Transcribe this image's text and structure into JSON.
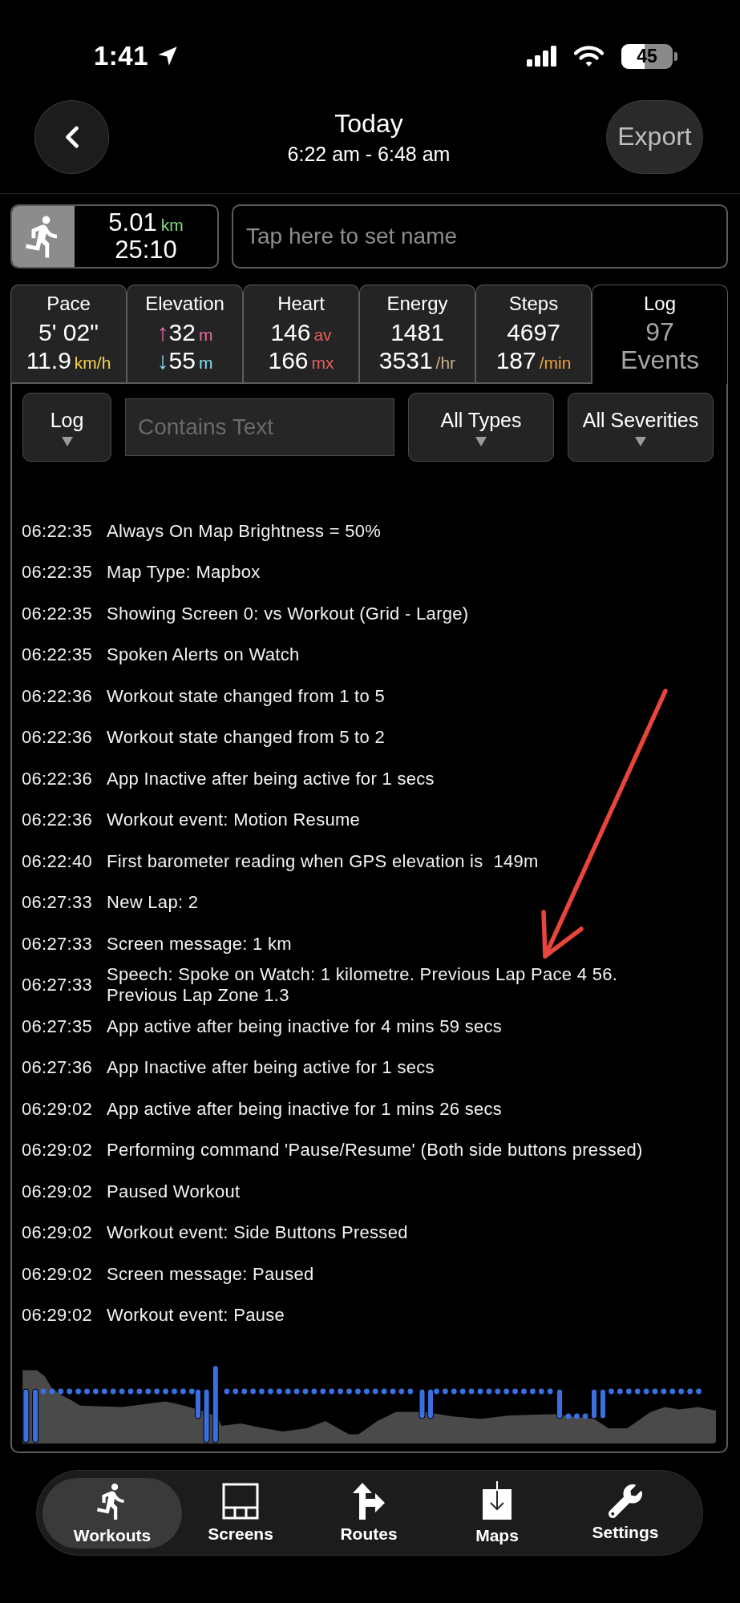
{
  "status_bar": {
    "time": "1:41",
    "battery": "45"
  },
  "header": {
    "title": "Today",
    "subtitle": "6:22 am - 6:48 am",
    "export_button": "Export"
  },
  "summary": {
    "distance": "5.01",
    "distance_unit": "km",
    "duration": "25:10",
    "name_field": {
      "placeholder": "Tap here to set name"
    }
  },
  "stat_tabs": [
    {
      "label": "Pace",
      "selected": false,
      "lines": [
        {
          "value": "5' 02\""
        },
        {
          "value": "11.9",
          "unit": "km/h",
          "color": "#f4d24c"
        }
      ]
    },
    {
      "label": "Elevation",
      "selected": false,
      "lines": [
        {
          "arrow": "↑",
          "value": "32",
          "unit": "m",
          "color": "#ec6aa6"
        },
        {
          "arrow": "↓",
          "value": "55",
          "unit": "m",
          "color": "#7fe0ee"
        }
      ]
    },
    {
      "label": "Heart",
      "selected": false,
      "lines": [
        {
          "value": "146",
          "unit": "av",
          "color": "#e4605a"
        },
        {
          "value": "166",
          "unit": "mx",
          "color": "#e4605a"
        }
      ]
    },
    {
      "label": "Energy",
      "selected": false,
      "lines": [
        {
          "value": "1481"
        },
        {
          "value": "3531",
          "unit": "/hr",
          "color": "#c8b08e"
        }
      ]
    },
    {
      "label": "Steps",
      "selected": false,
      "lines": [
        {
          "value": "4697"
        },
        {
          "value": "187",
          "unit": "/min",
          "color": "#f0a23c"
        }
      ]
    },
    {
      "label": "Log",
      "selected": true,
      "lines": [
        {
          "value": "97"
        },
        {
          "value": "Events"
        }
      ]
    }
  ],
  "filters": {
    "source": "Log",
    "search": {
      "placeholder": "Contains Text"
    },
    "type": "All Types",
    "severity": "All Severities"
  },
  "log": [
    {
      "time": "06:22:35",
      "message": "Always On Map Brightness = 50%"
    },
    {
      "time": "06:22:35",
      "message": "Map Type: Mapbox"
    },
    {
      "time": "06:22:35",
      "message": "Showing Screen 0: vs Workout (Grid - Large)"
    },
    {
      "time": "06:22:35",
      "message": "Spoken Alerts on Watch"
    },
    {
      "time": "06:22:36",
      "message": "Workout state changed from 1 to 5"
    },
    {
      "time": "06:22:36",
      "message": "Workout state changed from 5 to 2"
    },
    {
      "time": "06:22:36",
      "message": "App Inactive after being active for 1 secs"
    },
    {
      "time": "06:22:36",
      "message": "Workout event: Motion Resume"
    },
    {
      "time": "06:22:40",
      "message": "First barometer reading when GPS elevation is  149m"
    },
    {
      "time": "06:27:33",
      "message": "New Lap: 2"
    },
    {
      "time": "06:27:33",
      "message": "Screen message: 1 km"
    },
    {
      "time": "06:27:33",
      "message": "Speech: Spoke on Watch: 1 kilometre. Previous Lap Pace 4 56. Previous Lap Zone 1.3"
    },
    {
      "time": "06:27:35",
      "message": "App active after being inactive for 4 mins 59 secs"
    },
    {
      "time": "06:27:36",
      "message": "App Inactive after being active for 1 secs"
    },
    {
      "time": "06:29:02",
      "message": "App active after being inactive for 1 mins 26 secs"
    },
    {
      "time": "06:29:02",
      "message": "Performing command 'Pause/Resume' (Both side buttons pressed)"
    },
    {
      "time": "06:29:02",
      "message": "Paused Workout"
    },
    {
      "time": "06:29:02",
      "message": "Workout event: Side Buttons Pressed"
    },
    {
      "time": "06:29:02",
      "message": "Screen message: Paused"
    },
    {
      "time": "06:29:02",
      "message": "Workout event: Pause"
    }
  ],
  "tab_bar": [
    {
      "label": "Workouts",
      "selected": true
    },
    {
      "label": "Screens",
      "selected": false
    },
    {
      "label": "Routes",
      "selected": false
    },
    {
      "label": "Maps",
      "selected": false
    },
    {
      "label": "Settings",
      "selected": false
    }
  ]
}
